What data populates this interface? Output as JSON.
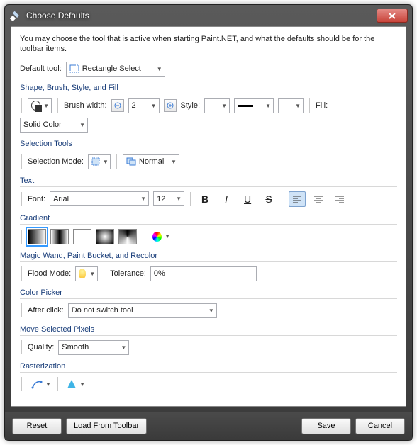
{
  "window": {
    "title": "Choose Defaults"
  },
  "intro": "You may choose the tool that is active when starting Paint.NET, and what the defaults should be for the toolbar items.",
  "default_tool": {
    "label": "Default tool:",
    "value": "Rectangle Select"
  },
  "shape_section": {
    "title": "Shape, Brush, Style, and Fill",
    "brush_width_label": "Brush width:",
    "brush_width_value": "2",
    "style_label": "Style:",
    "fill_label": "Fill:",
    "fill_value": "Solid Color"
  },
  "selection_section": {
    "title": "Selection Tools",
    "mode_label": "Selection Mode:",
    "mode_value": "Normal"
  },
  "text_section": {
    "title": "Text",
    "font_label": "Font:",
    "font_value": "Arial",
    "size_value": "12"
  },
  "gradient_section": {
    "title": "Gradient"
  },
  "magic_section": {
    "title": "Magic Wand, Paint Bucket, and Recolor",
    "flood_label": "Flood Mode:",
    "tolerance_label": "Tolerance:",
    "tolerance_value": "0%"
  },
  "picker_section": {
    "title": "Color Picker",
    "after_label": "After click:",
    "after_value": "Do not switch tool"
  },
  "move_section": {
    "title": "Move Selected Pixels",
    "quality_label": "Quality:",
    "quality_value": "Smooth"
  },
  "raster_section": {
    "title": "Rasterization"
  },
  "footer": {
    "reset": "Reset",
    "load": "Load From Toolbar",
    "save": "Save",
    "cancel": "Cancel"
  }
}
